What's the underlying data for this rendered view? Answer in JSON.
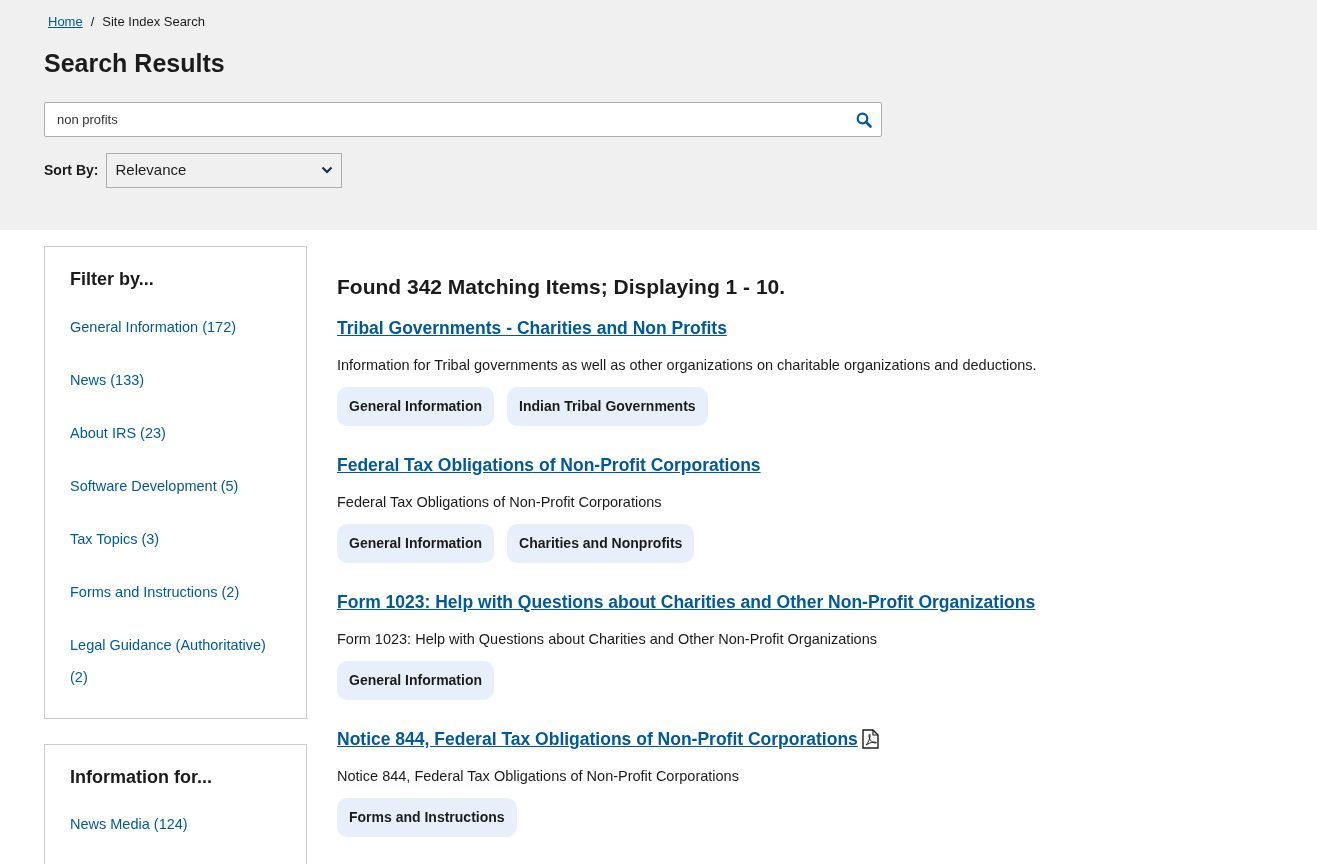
{
  "breadcrumb": [
    {
      "label": "Home",
      "link": true
    },
    {
      "label": "Site Index Search",
      "link": false
    }
  ],
  "breadcrumb_separator": "/",
  "title": "Search Results",
  "search": {
    "value": "non profits"
  },
  "sort": {
    "label": "Sort By:",
    "value": "Relevance"
  },
  "filters": [
    {
      "heading": "Filter by...",
      "items": [
        "General Information (172)",
        "News (133)",
        "About IRS (23)",
        "Software Development (5)",
        "Tax Topics (3)",
        "Forms and Instructions (2)",
        "Legal Guidance (Authoritative) (2)"
      ]
    },
    {
      "heading": "Information for...",
      "items": [
        "News Media (124)"
      ]
    }
  ],
  "summary": "Found 342 Matching Items; Displaying 1 - 10.",
  "results": [
    {
      "title": "Tribal Governments - Charities and Non Profits",
      "pdf": false,
      "description": "Information for Tribal governments as well as other organizations on charitable organizations and deductions.",
      "tags": [
        "General Information",
        "Indian Tribal Governments"
      ]
    },
    {
      "title": "Federal Tax Obligations of Non-Profit Corporations",
      "pdf": false,
      "description": "Federal Tax Obligations of Non-Profit Corporations",
      "tags": [
        "General Information",
        "Charities and Nonprofits"
      ]
    },
    {
      "title": "Form 1023: Help with Questions about Charities and Other Non-Profit Organizations",
      "pdf": false,
      "description": "Form 1023: Help with Questions about Charities and Other Non-Profit Organizations",
      "tags": [
        "General Information"
      ]
    },
    {
      "title": "Notice 844, Federal Tax Obligations of Non-Profit Corporations",
      "pdf": true,
      "description": "Notice 844, Federal Tax Obligations of Non-Profit Corporations",
      "tags": [
        "Forms and Instructions"
      ]
    }
  ]
}
